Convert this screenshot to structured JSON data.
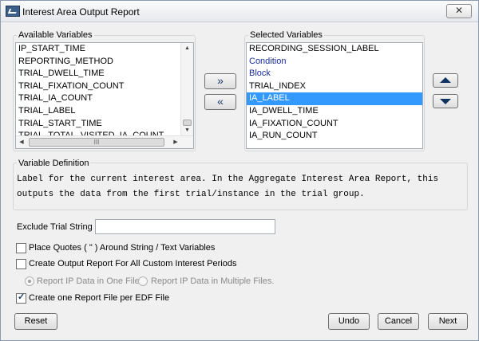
{
  "window": {
    "title": "Interest Area Output Report",
    "close_label": "✕"
  },
  "available": {
    "label": "Available Variables",
    "items": [
      "IP_START_TIME",
      "REPORTING_METHOD",
      "TRIAL_DWELL_TIME",
      "TRIAL_FIXATION_COUNT",
      "TRIAL_IA_COUNT",
      "TRIAL_LABEL",
      "TRIAL_START_TIME",
      "TRIAL_TOTAL_VISITED_IA_COUNT"
    ],
    "scroll_up": "▲",
    "scroll_down": "▼",
    "scroll_left": "◀",
    "scroll_right": "▶",
    "hthumb_grip": "III"
  },
  "move_buttons": {
    "add_label": "»",
    "remove_label": "«"
  },
  "selected": {
    "label": "Selected Variables",
    "items": [
      {
        "text": "RECORDING_SESSION_LABEL",
        "style": "normal"
      },
      {
        "text": "Condition",
        "style": "blue"
      },
      {
        "text": "Block",
        "style": "blue"
      },
      {
        "text": "TRIAL_INDEX",
        "style": "normal"
      },
      {
        "text": "IA_LABEL",
        "style": "selected"
      },
      {
        "text": "IA_DWELL_TIME",
        "style": "normal"
      },
      {
        "text": "IA_FIXATION_COUNT",
        "style": "normal"
      },
      {
        "text": "IA_RUN_COUNT",
        "style": "normal"
      }
    ]
  },
  "definition": {
    "label": "Variable Definition",
    "line1": "Label for the current interest area. In the Aggregate Interest Area Report, this",
    "line2": "outputs the data from the first trial/instance in the trial group."
  },
  "exclude": {
    "label": "Exclude Trial String :",
    "value": ""
  },
  "options": {
    "place_quotes": {
      "label": "Place Quotes ( \" ) Around String / Text Variables",
      "checked": false
    },
    "custom_periods": {
      "label": "Create Output Report For All Custom Interest Periods",
      "checked": false
    },
    "ip_one_file": {
      "label": "Report IP Data in One File.",
      "checked": true
    },
    "ip_multiple_files": {
      "label": "Report IP Data in Multiple Files.",
      "checked": false
    },
    "one_per_edf": {
      "label": "Create one Report File per EDF File",
      "checked": true
    }
  },
  "buttons": {
    "reset": "Reset",
    "undo": "Undo",
    "cancel": "Cancel",
    "next": "Next"
  },
  "colors": {
    "selection": "#3399ff",
    "blue_text": "#1a2e9a",
    "arrow_icon": "#10335f"
  }
}
